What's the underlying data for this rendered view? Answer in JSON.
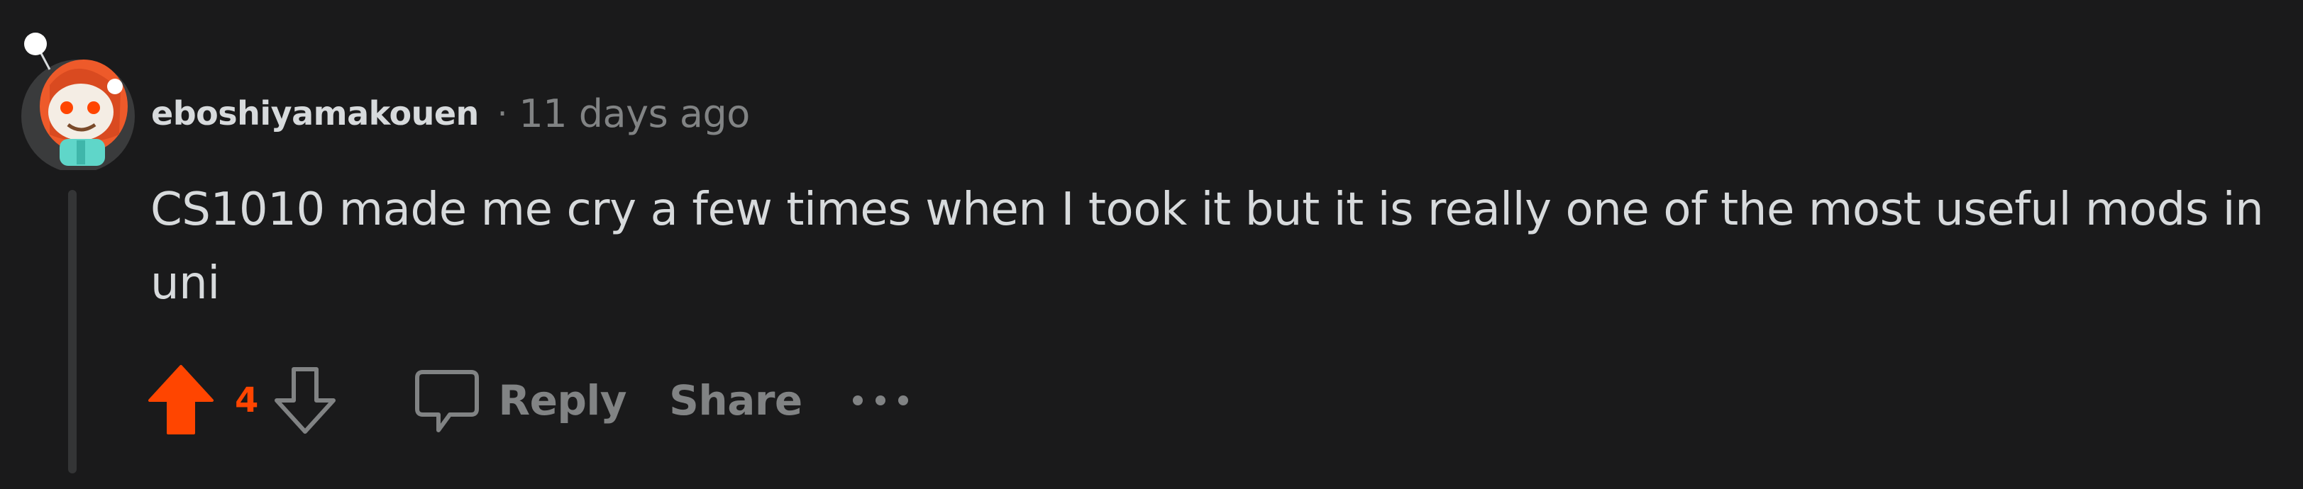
{
  "comment": {
    "author": "eboshiyamakouen",
    "separator": "·",
    "timestamp": "11 days ago",
    "body": "CS1010 made me cry a few times when I took it but it is really one of the most useful mods in uni"
  },
  "actions": {
    "score": "4",
    "upvoted": true,
    "reply_label": "Reply",
    "share_label": "Share"
  },
  "icons": {
    "avatar": "snoo-avatar",
    "upvote": "arrow-up-icon",
    "downvote": "arrow-down-icon",
    "comment": "speech-bubble-icon",
    "more": "ellipsis-icon"
  },
  "colors": {
    "background": "#1a1a1b",
    "upvote_active": "#ff4500",
    "muted": "#818384",
    "text": "#d7dadc"
  }
}
